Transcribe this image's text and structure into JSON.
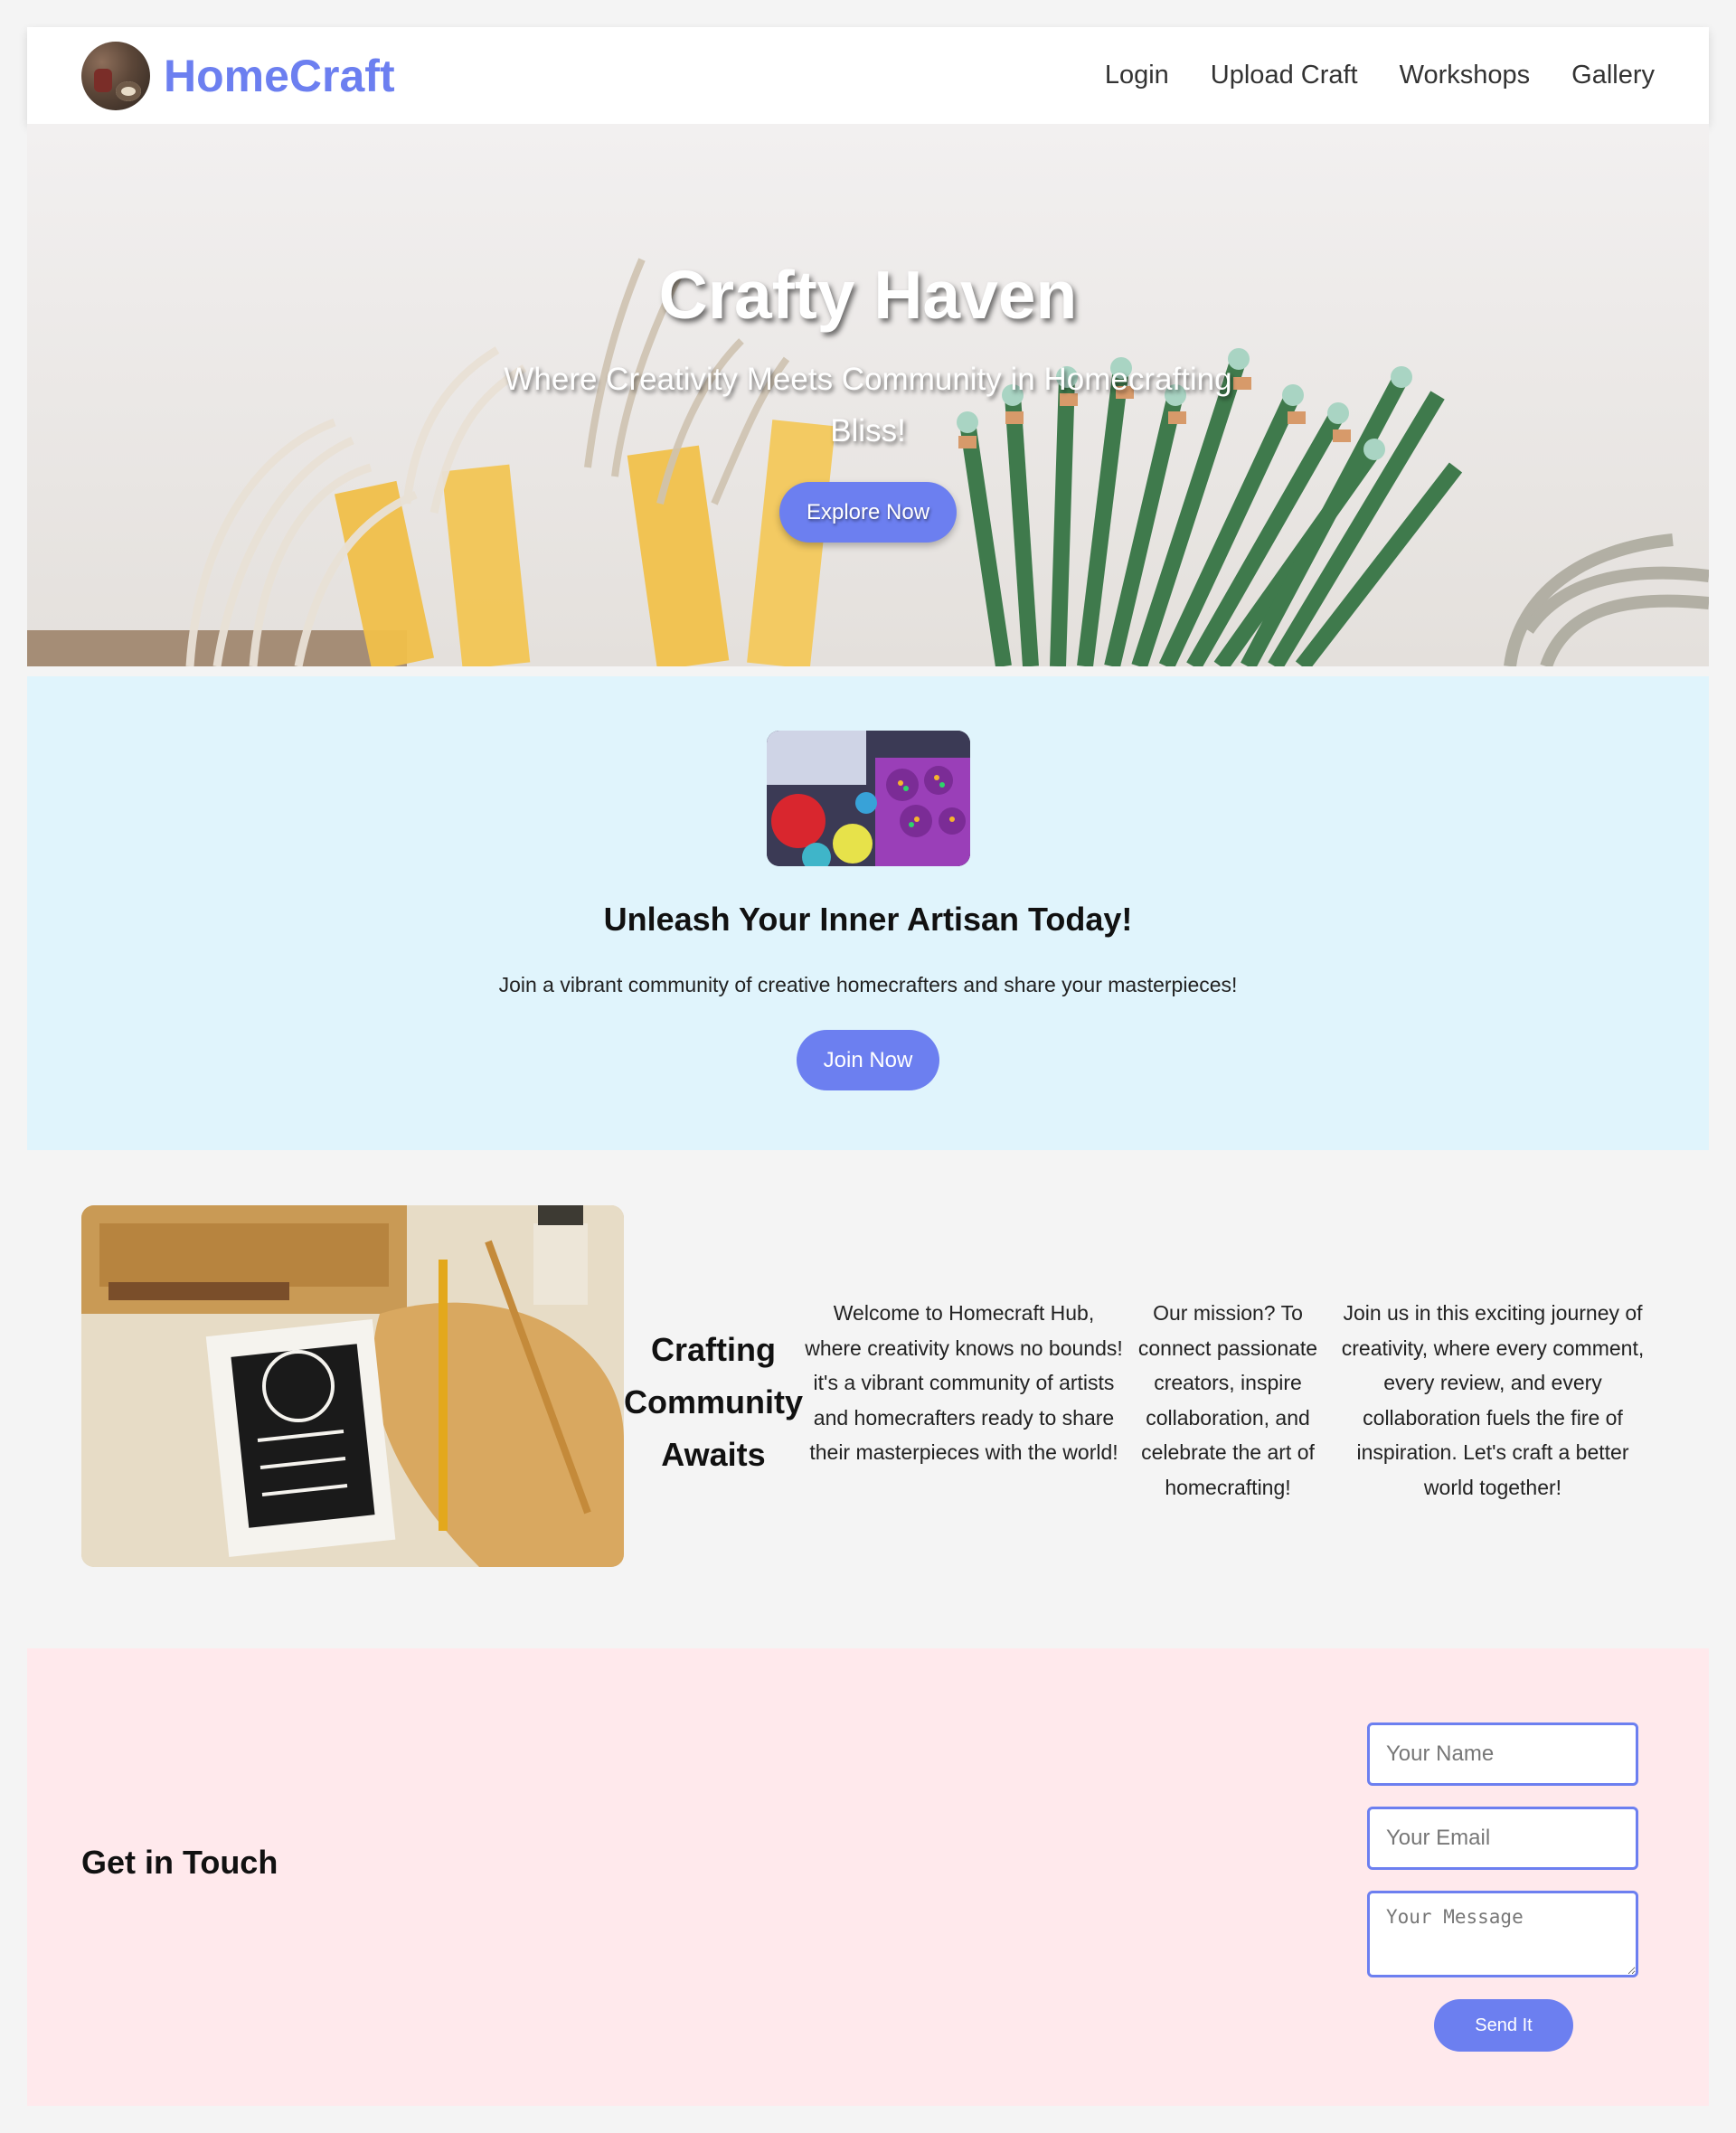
{
  "brand": {
    "name": "HomeCraft",
    "logo_icon": "craft-logo-icon",
    "color": "#6c7ff0"
  },
  "nav": [
    {
      "label": "Login"
    },
    {
      "label": "Upload Craft"
    },
    {
      "label": "Workshops"
    },
    {
      "label": "Gallery"
    }
  ],
  "hero": {
    "title": "Crafty Haven",
    "subtitle": "Where Creativity Meets Community in Homecrafting Bliss!",
    "button": "Explore Now"
  },
  "cta": {
    "title": "Unleash Your Inner Artisan Today!",
    "text": "Join a vibrant community of creative homecrafters and share your masterpieces!",
    "button": "Join Now",
    "background": "#e0f4fc"
  },
  "about": {
    "title": "Crafting Community Awaits",
    "columns": [
      "Welcome to Homecraft Hub, where creativity knows no bounds! it's a vibrant community of artists and homecrafters ready to share their masterpieces with the world!",
      "Our mission? To connect passionate creators, inspire collaboration, and celebrate the art of homecrafting!",
      "Join us in this exciting journey of creativity, where every comment, every review, and every collaboration fuels the fire of inspiration. Let's craft a better world together!"
    ]
  },
  "contact": {
    "title": "Get in Touch",
    "name_placeholder": "Your Name",
    "email_placeholder": "Your Email",
    "message_placeholder": "Your Message",
    "button": "Send It",
    "background": "#ffe9ec"
  }
}
